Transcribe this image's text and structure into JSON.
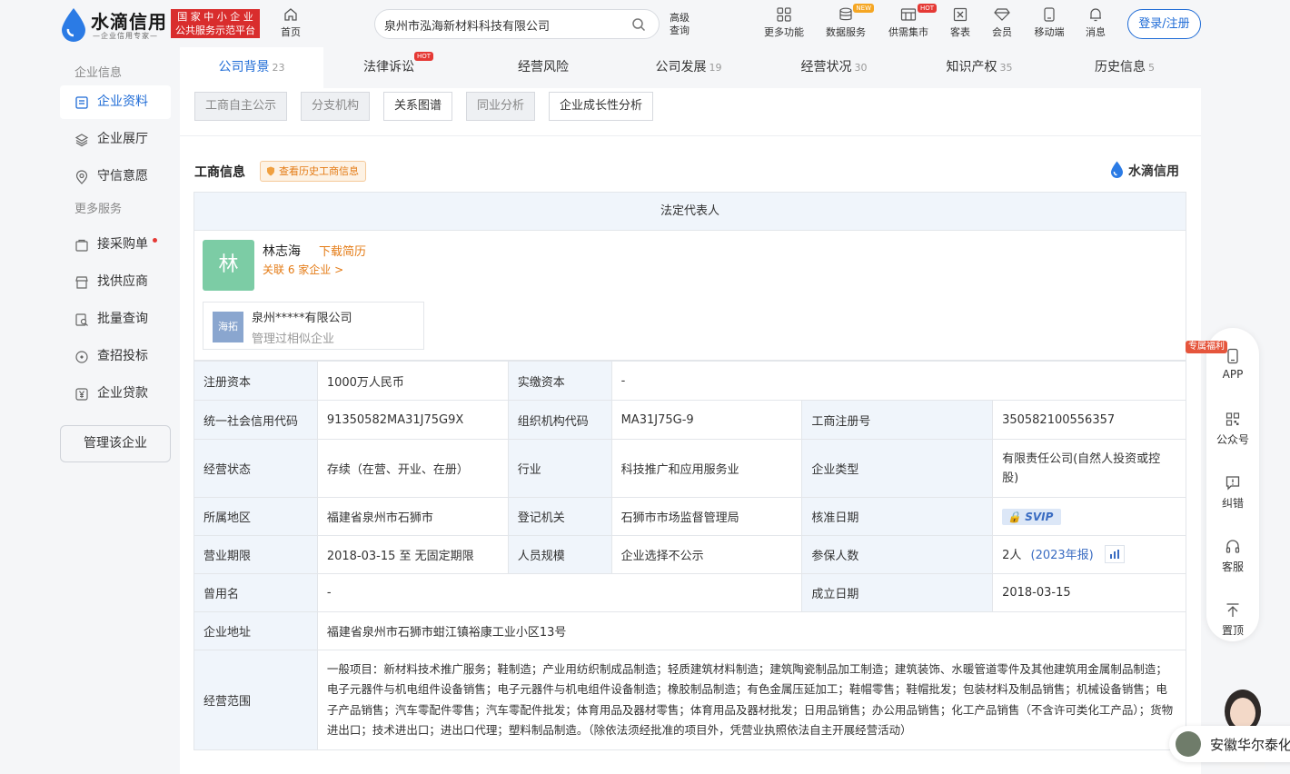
{
  "header": {
    "brand_name": "水滴信用",
    "brand_slogan": "—企业信用专家—",
    "badge_line1": "国 家 中 小 企 业",
    "badge_line2": "公共服务示范平台",
    "home_label": "首页",
    "search_value": "泉州市泓海新材料科技有限公司",
    "advanced_line1": "高级",
    "advanced_line2": "查询",
    "nav": [
      {
        "label": "更多功能",
        "icon": "grid-icon",
        "tag": ""
      },
      {
        "label": "数据服务",
        "icon": "database-icon",
        "tag": "NEW"
      },
      {
        "label": "供需集市",
        "icon": "market-icon",
        "tag": "HOT"
      },
      {
        "label": "客表",
        "icon": "excel-icon",
        "tag": ""
      },
      {
        "label": "会员",
        "icon": "diamond-icon",
        "tag": ""
      },
      {
        "label": "移动端",
        "icon": "mobile-icon",
        "tag": ""
      },
      {
        "label": "消息",
        "icon": "bell-icon",
        "tag": ""
      }
    ],
    "login_label": "登录/注册"
  },
  "sidebar": {
    "section1": "企业信息",
    "items1": [
      {
        "label": "企业资料",
        "icon": "document-icon"
      },
      {
        "label": "企业展厅",
        "icon": "layers-icon"
      },
      {
        "label": "守信意愿",
        "icon": "location-icon"
      }
    ],
    "section2": "更多服务",
    "items2": [
      {
        "label": "接采购单",
        "icon": "purchase-icon"
      },
      {
        "label": "找供应商",
        "icon": "store-icon"
      },
      {
        "label": "批量查询",
        "icon": "batch-search-icon"
      },
      {
        "label": "查招投标",
        "icon": "bid-icon"
      },
      {
        "label": "企业贷款",
        "icon": "yen-icon"
      }
    ],
    "manage_label": "管理该企业"
  },
  "tabs": [
    {
      "label": "公司背景",
      "count": "23",
      "hot": ""
    },
    {
      "label": "法律诉讼",
      "count": "",
      "hot": "HOT"
    },
    {
      "label": "经营风险",
      "count": "",
      "hot": ""
    },
    {
      "label": "公司发展",
      "count": "19",
      "hot": ""
    },
    {
      "label": "经营状况",
      "count": "30",
      "hot": ""
    },
    {
      "label": "知识产权",
      "count": "35",
      "hot": ""
    },
    {
      "label": "历史信息",
      "count": "5",
      "hot": ""
    }
  ],
  "subtabs": [
    "工商自主公示",
    "分支机构",
    "关系图谱",
    "同业分析",
    "企业成长性分析"
  ],
  "section": {
    "title": "工商信息",
    "history_label": "查看历史工商信息",
    "brand": "水滴信用"
  },
  "legal": {
    "header": "法定代表人",
    "avatar_char": "林",
    "name": "林志海",
    "download_label": "下载简历",
    "related_label": "关联 6 家企业 >",
    "similar_logo": "海拓",
    "similar_company": "泉州*****有限公司",
    "similar_desc": "管理过相似企业"
  },
  "info": {
    "reg_capital_k": "注册资本",
    "reg_capital_v": "1000万人民币",
    "paid_capital_k": "实缴资本",
    "paid_capital_v": "-",
    "credit_code_k": "统一社会信用代码",
    "credit_code_v": "91350582MA31J75G9X",
    "org_code_k": "组织机构代码",
    "org_code_v": "MA31J75G-9",
    "reg_no_k": "工商注册号",
    "reg_no_v": "350582100556357",
    "status_k": "经营状态",
    "status_v": "存续（在营、开业、在册）",
    "industry_k": "行业",
    "industry_v": "科技推广和应用服务业",
    "type_k": "企业类型",
    "type_v": "有限责任公司(自然人投资或控股)",
    "region_k": "所属地区",
    "region_v": "福建省泉州市石狮市",
    "authority_k": "登记机关",
    "authority_v": "石狮市市场监督管理局",
    "approve_k": "核准日期",
    "approve_v": "SVIP",
    "term_k": "营业期限",
    "term_v": "2018-03-15 至 无固定期限",
    "staff_k": "人员规模",
    "staff_v": "企业选择不公示",
    "insured_k": "参保人数",
    "insured_v": "2人",
    "insured_link": "(2023年报)",
    "former_k": "曾用名",
    "former_v": "-",
    "founded_k": "成立日期",
    "founded_v": "2018-03-15",
    "address_k": "企业地址",
    "address_v": "福建省泉州市石狮市蚶江镇裕康工业小区13号",
    "scope_k": "经营范围",
    "scope_v": "一般项目：新材料技术推广服务；鞋制造；产业用纺织制成品制造；轻质建筑材料制造；建筑陶瓷制品加工制造；建筑装饰、水暖管道零件及其他建筑用金属制品制造；电子元器件与机电组件设备销售；电子元器件与机电组件设备制造；橡胶制品制造；有色金属压延加工；鞋帽零售；鞋帽批发；包装材料及制品销售；机械设备销售；电子产品销售；汽车零配件零售；汽车零配件批发；体育用品及器材零售；体育用品及器材批发；日用品销售；办公用品销售；化工产品销售（不含许可类化工产品）；货物进出口；技术进出口；进出口代理；塑料制品制造。（除依法须经批准的项目外，凭营业执照依法自主开展经营活动）"
  },
  "float": {
    "tag": "专属福利",
    "items": [
      "APP",
      "公众号",
      "纠错",
      "客服",
      "置顶"
    ]
  },
  "agent": {
    "label": "安徽华尔泰化"
  },
  "colors": {
    "accent": "#1e6bd6",
    "orange": "#e47b15",
    "red": "#e53935",
    "table_key_bg": "#f0f5fb"
  }
}
